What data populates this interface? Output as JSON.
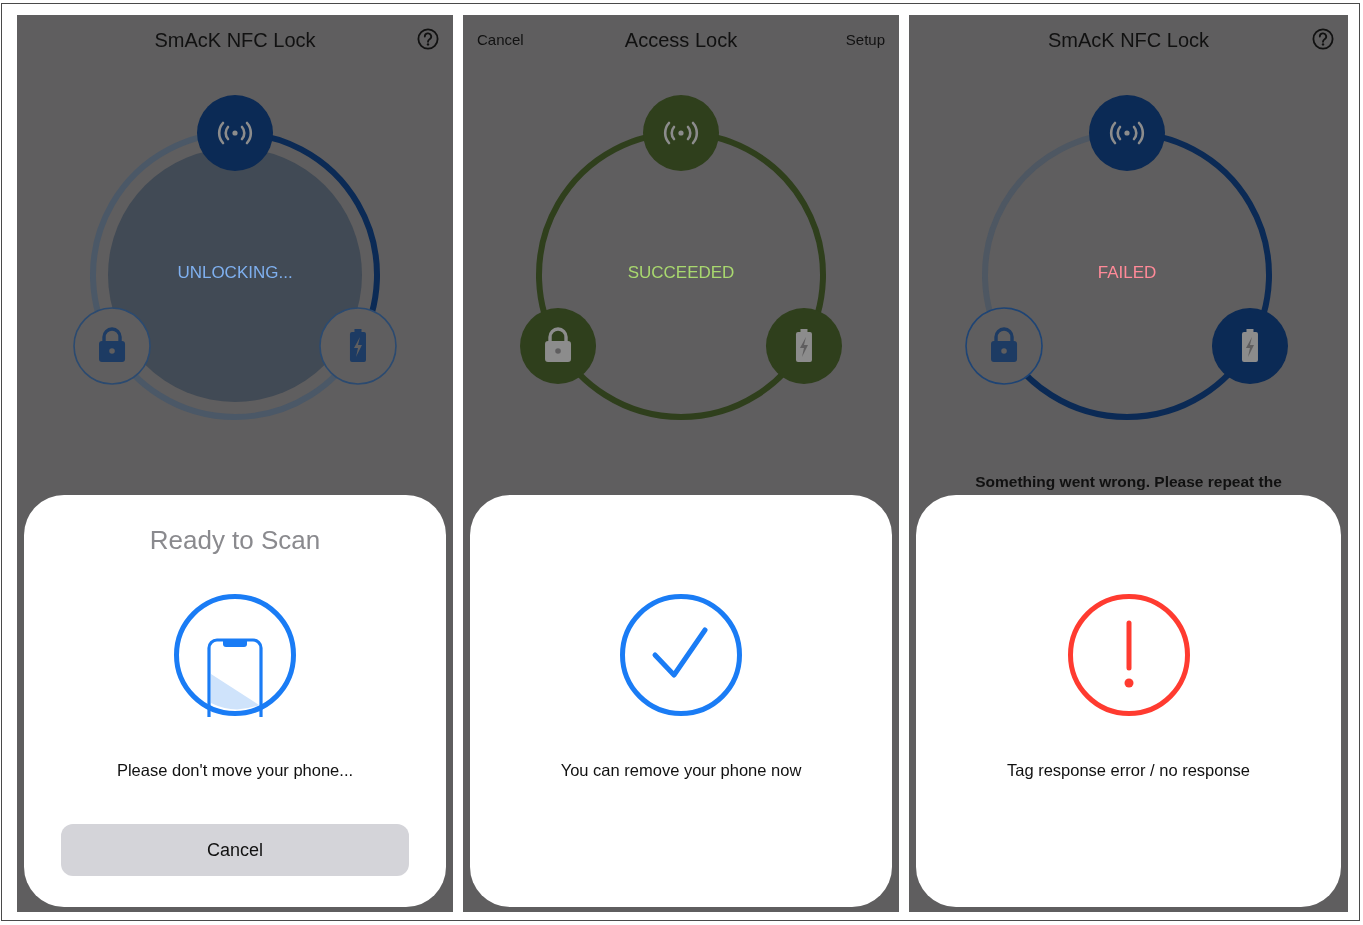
{
  "panels": [
    {
      "header": {
        "title": "SmAcK NFC Lock",
        "help": true
      },
      "ring": {
        "kind": "unlocking",
        "status": "UNLOCKING...",
        "segments": [
          {
            "done": true
          },
          {
            "done": false
          },
          {
            "done": false
          }
        ],
        "nodes": [
          {
            "kind": "nfc",
            "active": true
          },
          {
            "kind": "lock",
            "active": false
          },
          {
            "kind": "battery",
            "active": false
          }
        ]
      },
      "sheet": {
        "title": "Ready to Scan",
        "message": "Please don't move your phone...",
        "button": "Cancel"
      }
    },
    {
      "header": {
        "left_button": "Cancel",
        "title": "Access Lock",
        "right_button": "Setup",
        "help": false
      },
      "ring": {
        "kind": "succeeded",
        "status": "SUCCEEDED",
        "segments": [
          {
            "done": true
          },
          {
            "done": true
          },
          {
            "done": true
          }
        ],
        "nodes": [
          {
            "kind": "nfc",
            "active": true
          },
          {
            "kind": "lock",
            "active": true
          },
          {
            "kind": "battery",
            "active": true
          }
        ]
      },
      "sheet": {
        "message": "You can remove your phone now"
      }
    },
    {
      "header": {
        "title": "SmAcK NFC Lock",
        "help": true
      },
      "ring": {
        "kind": "failed",
        "status": "FAILED",
        "segments": [
          {
            "done": true
          },
          {
            "done": true
          },
          {
            "done": false
          }
        ],
        "nodes": [
          {
            "kind": "nfc",
            "active": true
          },
          {
            "kind": "lock",
            "active": false
          },
          {
            "kind": "battery",
            "active": true
          }
        ]
      },
      "note": "Something went wrong. Please repeat the",
      "sheet": {
        "message": "Tag response error / no response"
      }
    }
  ]
}
